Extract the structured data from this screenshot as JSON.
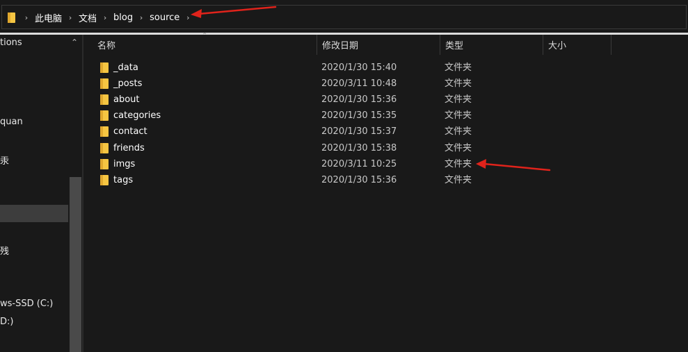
{
  "address_bar": {
    "breadcrumbs": [
      "此电脑",
      "文档",
      "blog",
      "source"
    ]
  },
  "nav_pane": {
    "items": [
      "tions",
      "quan",
      "汞",
      "残",
      "ws-SSD (C:)",
      "D:)"
    ]
  },
  "file_list": {
    "columns": {
      "name": "名称",
      "date": "修改日期",
      "type": "类型",
      "size": "大小"
    },
    "rows": [
      {
        "name": "_data",
        "date": "2020/1/30 15:40",
        "type": "文件夹"
      },
      {
        "name": "_posts",
        "date": "2020/3/11 10:48",
        "type": "文件夹"
      },
      {
        "name": "about",
        "date": "2020/1/30 15:36",
        "type": "文件夹"
      },
      {
        "name": "categories",
        "date": "2020/1/30 15:35",
        "type": "文件夹"
      },
      {
        "name": "contact",
        "date": "2020/1/30 15:37",
        "type": "文件夹"
      },
      {
        "name": "friends",
        "date": "2020/1/30 15:38",
        "type": "文件夹"
      },
      {
        "name": "imgs",
        "date": "2020/3/11 10:25",
        "type": "文件夹"
      },
      {
        "name": "tags",
        "date": "2020/1/30 15:36",
        "type": "文件夹"
      }
    ]
  },
  "icons": {
    "folder": "folder-icon",
    "breadcrumb_separator": "chevron-right-icon",
    "collapse": "chevron-up-icon",
    "sort": "sort-up-icon"
  },
  "colors": {
    "background": "#191919",
    "folder": "#f5c542",
    "annotation_arrow": "#e0231b",
    "selected_nav": "#3d3d3d"
  }
}
